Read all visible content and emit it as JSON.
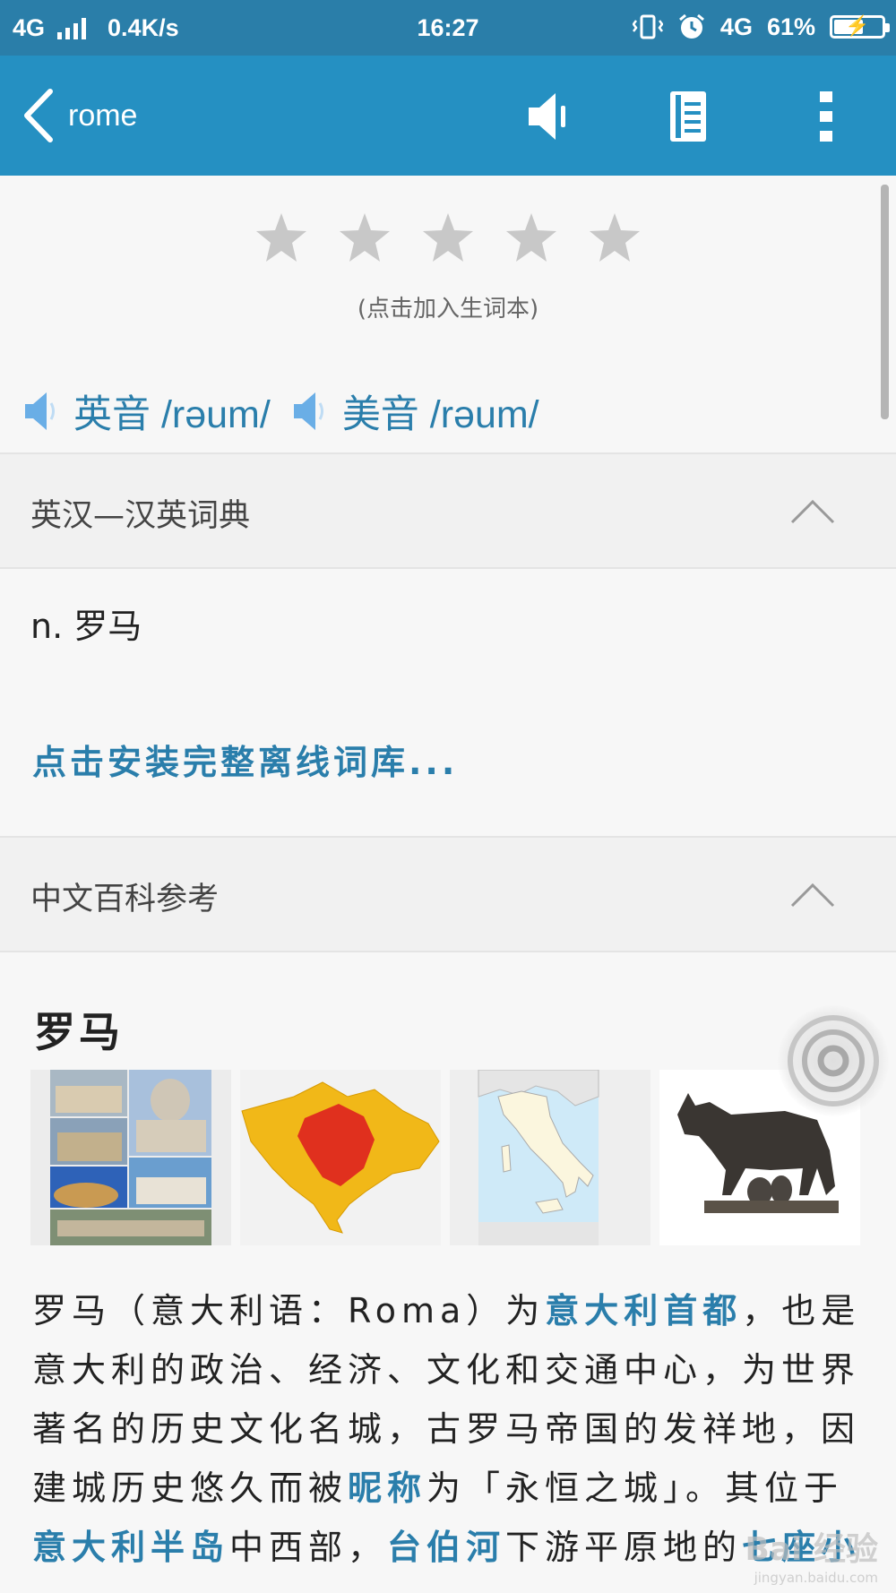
{
  "status_bar": {
    "network": "4G",
    "speed": "0.4K/s",
    "time": "16:27",
    "network_right": "4G",
    "battery_percent_text": "61%",
    "battery_level": 0.61
  },
  "app_bar": {
    "title": "rome",
    "icons": [
      "back-icon",
      "speaker-icon",
      "notebook-icon",
      "more-vert-icon"
    ]
  },
  "rating": {
    "stars_filled": 0,
    "stars_total": 5,
    "hint": "(点击加入生词本)"
  },
  "pronunciation": {
    "uk_label": "英音 /rəum/",
    "us_label": "美音 /rəum/"
  },
  "dictionary_section": {
    "title": "英汉—汉英词典",
    "definition": "n. 罗马",
    "install_link": "点击安装完整离线词库..."
  },
  "baike_section": {
    "title": "中文百科参考",
    "entry_title": "罗马",
    "paragraph": [
      {
        "text": "罗马（意大利语：Roma）为",
        "link": false
      },
      {
        "text": "意大利首都",
        "link": true
      },
      {
        "text": "，也是意大利的政治、经济、文化和交通中心，为世界著名的历史文化名城，古罗马帝国的发祥地，因建城历史悠久而被",
        "link": false
      },
      {
        "text": "昵称",
        "link": true
      },
      {
        "text": "为「永恒之城」。其位于",
        "link": false
      },
      {
        "text": "意大利半岛",
        "link": true
      },
      {
        "text": "中西部，",
        "link": false
      },
      {
        "text": "台伯河",
        "link": true
      },
      {
        "text": "下游平原地的",
        "link": false
      },
      {
        "text": "七座小",
        "link": true
      }
    ]
  },
  "watermark": {
    "text": "Bai 经验",
    "sub": "jingyan.baidu.com"
  },
  "colors": {
    "status_bar": "#2a7ea9",
    "app_bar": "#2590c2",
    "link": "#2a7eab",
    "star": "#c8c8c8"
  }
}
